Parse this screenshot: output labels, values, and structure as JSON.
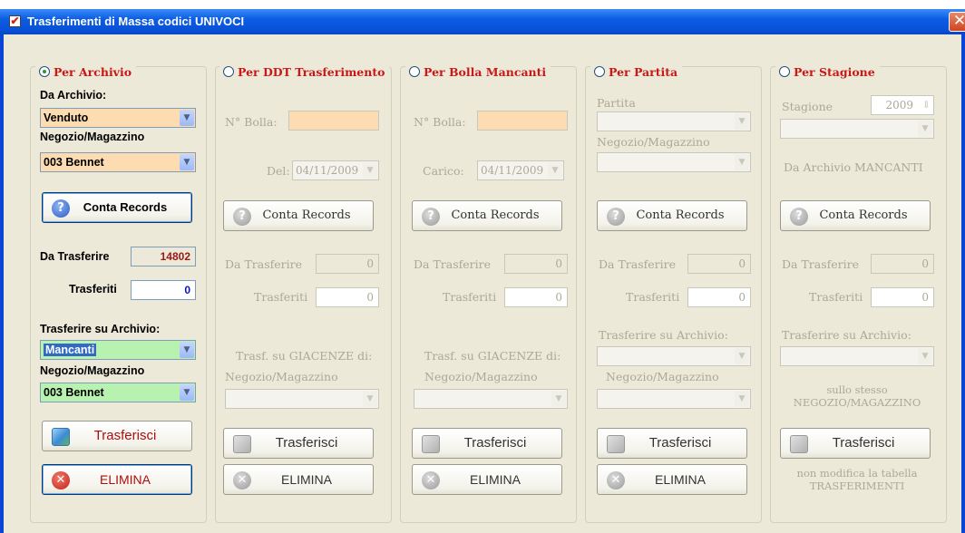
{
  "window": {
    "title": "Trasferimenti di Massa codici UNIVOCI",
    "close": "✕"
  },
  "col1": {
    "radio": "Per Archivio",
    "da_archivio_label": "Da Archivio:",
    "da_archivio_value": "Venduto",
    "negozio_label": "Negozio/Magazzino",
    "negozio_value": "003  Bennet",
    "conta": "Conta Records",
    "da_trasferire_label": "Da Trasferire",
    "da_trasferire_value": "14802",
    "trasferiti_label": "Trasferiti",
    "trasferiti_value": "0",
    "trasferire_su_label": "Trasferire su Archivio:",
    "trasferire_su_value": "Mancanti",
    "negozio2_label": "Negozio/Magazzino",
    "negozio2_value": "003  Bennet",
    "trasferisci": "Trasferisci",
    "elimina": "ELIMINA"
  },
  "col2": {
    "radio": "Per DDT Trasferimento",
    "bolla_label": "N° Bolla:",
    "bolla_value": "",
    "del_label": "Del:",
    "del_value": "04/11/2009",
    "conta": "Conta Records",
    "da_trasferire_label": "Da Trasferire",
    "da_trasferire_value": "0",
    "trasferiti_label": "Trasferiti",
    "trasferiti_value": "0",
    "giacenze_label": "Trasf. su GIACENZE di:",
    "negozio_label": "Negozio/Magazzino",
    "trasferisci": "Trasferisci",
    "elimina": "ELIMINA"
  },
  "col3": {
    "radio": "Per Bolla Mancanti",
    "bolla_label": "N° Bolla:",
    "bolla_value": "",
    "carico_label": "Carico:",
    "carico_value": "04/11/2009",
    "conta": "Conta Records",
    "da_trasferire_label": "Da Trasferire",
    "da_trasferire_value": "0",
    "trasferiti_label": "Trasferiti",
    "trasferiti_value": "0",
    "giacenze_label": "Trasf. su GIACENZE di:",
    "negozio_label": "Negozio/Magazzino",
    "trasferisci": "Trasferisci",
    "elimina": "ELIMINA"
  },
  "col4": {
    "radio": "Per Partita",
    "partita_label": "Partita",
    "negozio_label": "Negozio/Magazzino",
    "conta": "Conta Records",
    "da_trasferire_label": "Da Trasferire",
    "da_trasferire_value": "0",
    "trasferiti_label": "Trasferiti",
    "trasferiti_value": "0",
    "trasferire_su_label": "Trasferire su Archivio:",
    "negozio2_label": "Negozio/Magazzino",
    "trasferisci": "Trasferisci",
    "elimina": "ELIMINA"
  },
  "col5": {
    "radio": "Per Stagione",
    "stagione_label": "Stagione",
    "stagione_value": "2009",
    "mancanti_label": "Da Archivio MANCANTI",
    "conta": "Conta Records",
    "da_trasferire_label": "Da Trasferire",
    "da_trasferire_value": "0",
    "trasferiti_label": "Trasferiti",
    "trasferiti_value": "0",
    "trasferire_su_label": "Trasferire su Archivio:",
    "stesso_line1": "sullo stesso",
    "stesso_line2": "NEGOZIO/MAGAZZINO",
    "trasferisci": "Trasferisci",
    "note_line1": "non modifica la tabella",
    "note_line2": "TRASFERIMENTI"
  },
  "icons": {
    "question": "?",
    "cancel": "✕",
    "arrow": "▼",
    "spin": "⇕"
  },
  "colors": {
    "titlebar": "#0a50d6",
    "accent_red": "#c81818",
    "orange_field": "#fcdcb0",
    "green_field": "#b8f2b0"
  }
}
